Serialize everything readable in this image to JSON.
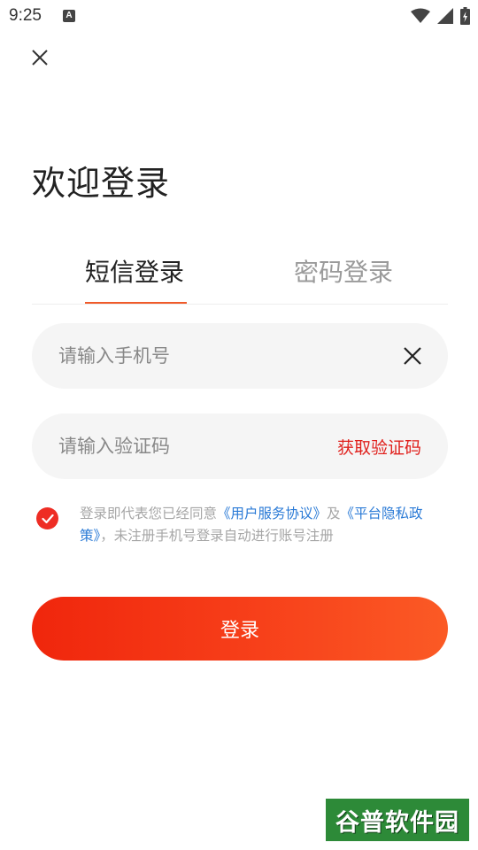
{
  "status_bar": {
    "time": "9:25",
    "indicator": "A",
    "icons": [
      "wifi-icon",
      "signal-icon",
      "battery-charging-icon"
    ]
  },
  "close": {
    "icon": "close-icon"
  },
  "heading": "欢迎登录",
  "tabs": [
    {
      "label": "短信登录",
      "active": true
    },
    {
      "label": "密码登录",
      "active": false
    }
  ],
  "phone_field": {
    "placeholder": "请输入手机号",
    "value": "",
    "clear_icon": "close-icon"
  },
  "code_field": {
    "placeholder": "请输入验证码",
    "value": "",
    "get_code_label": "获取验证码"
  },
  "agreement": {
    "checked": true,
    "prefix": "登录即代表您已经同意",
    "link1": "《用户服务协议》",
    "middle": "及",
    "link2": "《平台隐私政策》",
    "suffix": "，未注册手机号登录自动进行账号注册"
  },
  "login_button": {
    "label": "登录"
  },
  "watermark": "谷普软件园",
  "colors": {
    "accent": "#ee2d24",
    "link": "#2a7ad6",
    "tab_underline": "#f05a2a",
    "field_bg": "#f5f5f5"
  }
}
